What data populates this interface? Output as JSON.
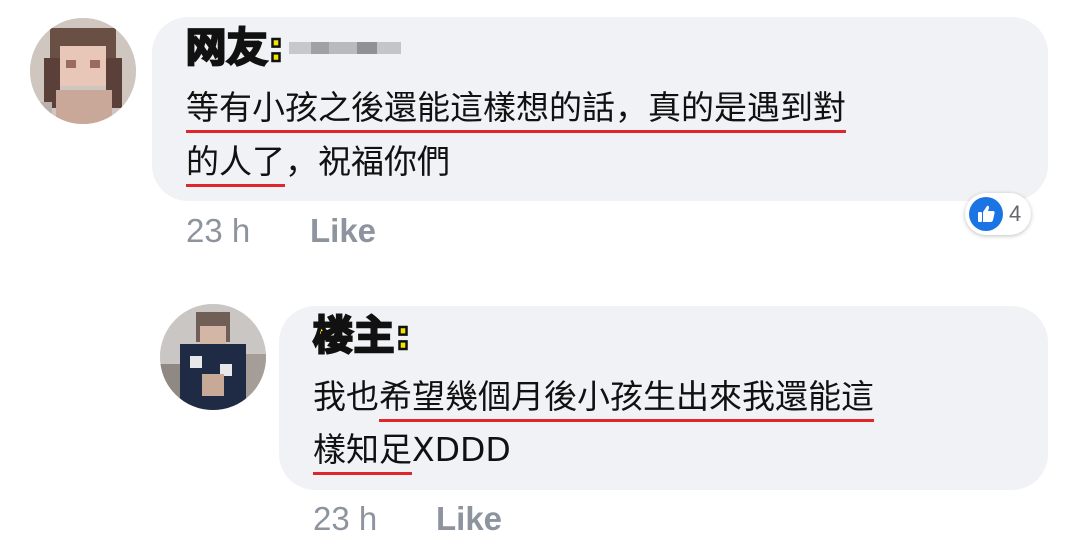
{
  "comment": {
    "label": "网友:",
    "line1": "等有小孩之後還能這樣想的話，真的是遇到對",
    "line2_underlined": "的人了",
    "line2_rest": "，祝福你們",
    "time": "23 h",
    "like_label": "Like",
    "reaction_icon": "thumbs-up-icon",
    "reaction_count": "4"
  },
  "reply": {
    "label": "楼主:",
    "line1_pre": "我也",
    "line1_underlined": "希望幾個月後小孩生出來我還能這",
    "line2_underlined": "樣知足",
    "line2_rest": "XDDD",
    "time": "23 h",
    "like_label": "Like"
  },
  "colors": {
    "bubble": "#f0f2f5",
    "label_fill": "#f5e400",
    "underline": "#e0262c",
    "meta_text": "#8d949e",
    "reaction_blue": "#1b74e4"
  }
}
